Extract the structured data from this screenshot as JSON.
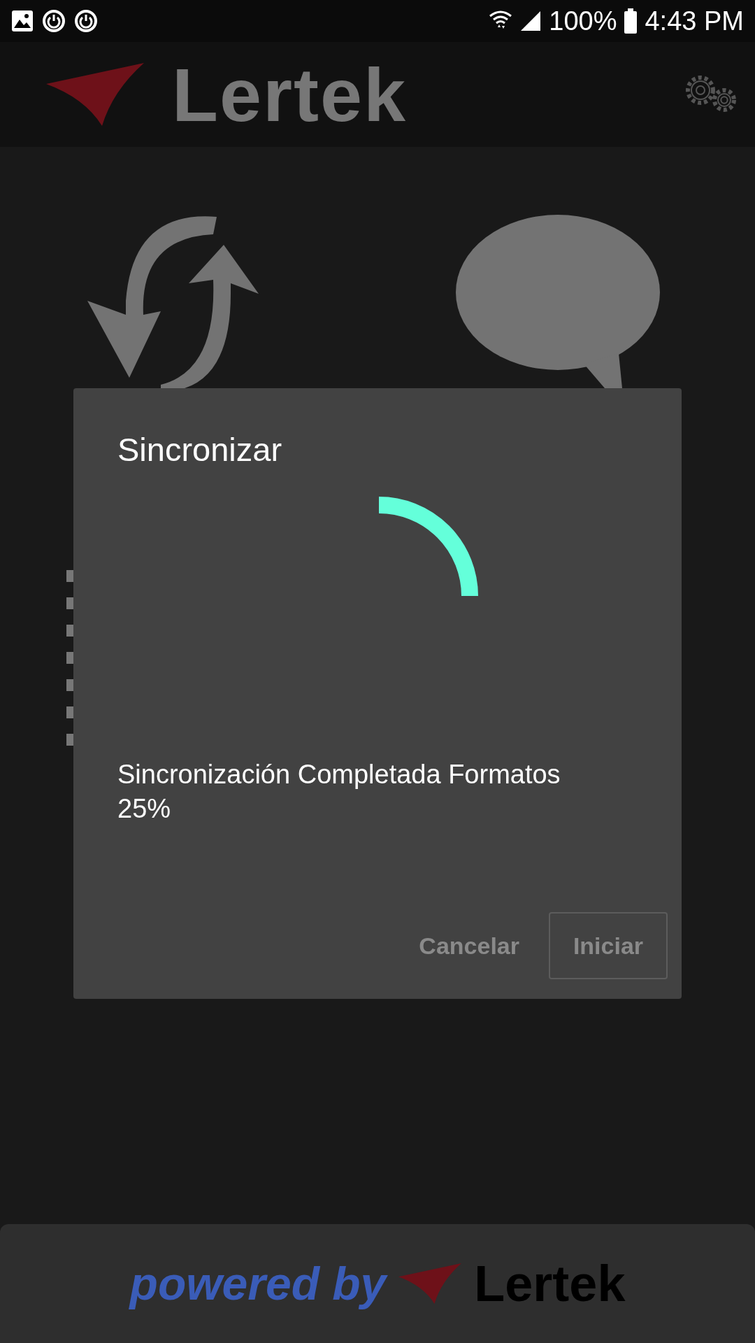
{
  "status_bar": {
    "battery": "100%",
    "time": "4:43 PM"
  },
  "header": {
    "logo_text": "Lertek"
  },
  "dialog": {
    "title": "Sincronizar",
    "message": "Sincronización Completada Formatos\n25%",
    "buttons": [
      {
        "label": "Cancelar",
        "kind": "text"
      },
      {
        "label": "Iniciar",
        "kind": "outlined"
      }
    ]
  },
  "footer": {
    "powered_by": "powered by",
    "logo_text": "Lertek"
  }
}
